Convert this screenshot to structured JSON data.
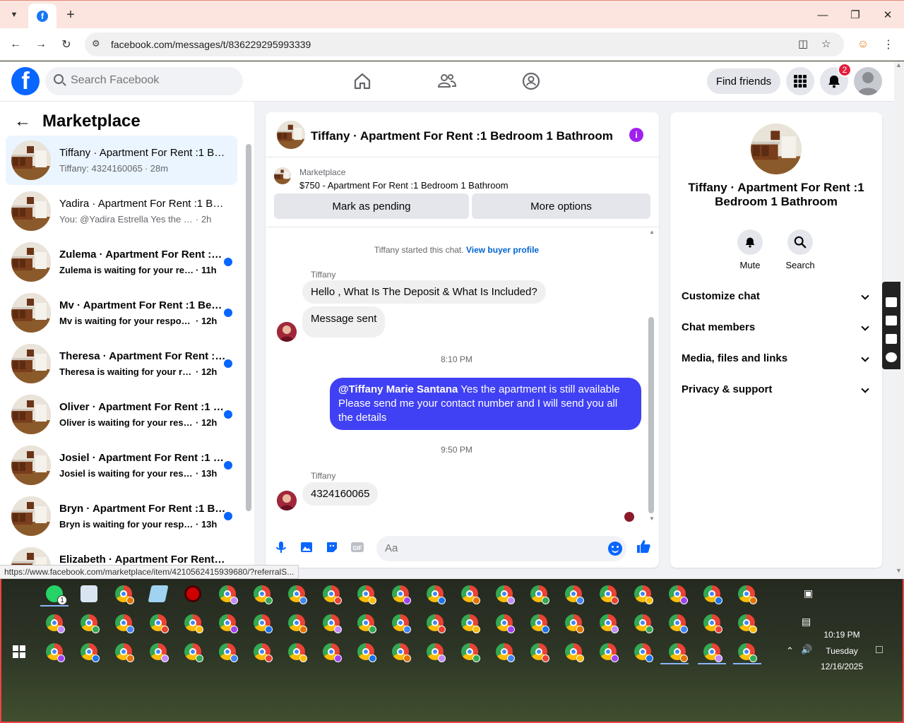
{
  "browser": {
    "url": "facebook.com/messages/t/836229295993339",
    "status_url": "https://www.facebook.com/marketplace/item/4210562415939680/?referralS..."
  },
  "fb_header": {
    "search_placeholder": "Search Facebook",
    "find_friends": "Find friends",
    "notification_count": "2"
  },
  "sidebar": {
    "title": "Marketplace",
    "conversations": [
      {
        "name": "Tiffany · Apartment For Rent :1 Bedroom 1 Bathroom",
        "preview": "Tiffany: 4324160065",
        "time": "· 28m",
        "unread": false,
        "active": true
      },
      {
        "name": "Yadira · Apartment For Rent :1 Bedroom 1 Bathroom",
        "preview": "You: @Yadira Estrella Yes the apartment is still available",
        "time": "· 2h",
        "unread": false,
        "active": false
      },
      {
        "name": "Zulema · Apartment For Rent :1 Bedroom 1 Bathroom",
        "preview": "Zulema is waiting for your response.",
        "time": "· 11h",
        "unread": true,
        "active": false
      },
      {
        "name": "Mv · Apartment For Rent :1 Bedroom 1 Bathroom",
        "preview": "Mv is waiting for your response.",
        "time": "· 12h",
        "unread": true,
        "active": false
      },
      {
        "name": "Theresa · Apartment For Rent :1 Bedroom 1 Bathroom",
        "preview": "Theresa is waiting for your response.",
        "time": "· 12h",
        "unread": true,
        "active": false
      },
      {
        "name": "Oliver · Apartment For Rent :1 Bedroom 1 Bathroom",
        "preview": "Oliver is waiting for your response.",
        "time": "· 12h",
        "unread": true,
        "active": false
      },
      {
        "name": "Josiel · Apartment For Rent :1 Bedroom 1 Bathroom",
        "preview": "Josiel is waiting for your response.",
        "time": "· 13h",
        "unread": true,
        "active": false
      },
      {
        "name": "Bryn · Apartment For Rent :1 Bedroom 1 Bathroom",
        "preview": "Bryn is waiting for your response.",
        "time": "· 13h",
        "unread": true,
        "active": false
      },
      {
        "name": "Elizabeth · Apartment For Rent :1 Bedroom 1 Bathroom",
        "preview": "",
        "time": "",
        "unread": true,
        "active": false
      }
    ]
  },
  "chat": {
    "title": "Tiffany · Apartment For Rent :1 Bedroom 1 Bathroom",
    "listing_source": "Marketplace",
    "listing_title": "$750 - Apartment For Rent :1 Bedroom 1 Bathroom",
    "mark_pending": "Mark as pending",
    "more_options": "More options",
    "started_text": "Tiffany started this chat.",
    "view_buyer": "View buyer profile",
    "sender_name": "Tiffany",
    "msg1": "Hello , What Is The Deposit & What Is Included?",
    "msg2": "Message sent",
    "time1": "8:10 PM",
    "out_mention": "@Tiffany Marie Santana",
    "out_text": " Yes the apartment is still available Please send me your contact number and I will send you all the details",
    "time2": "9:50 PM",
    "msg3": "4324160065",
    "composer_placeholder": "Aa"
  },
  "details": {
    "title": "Tiffany · Apartment For Rent :1 Bedroom 1 Bathroom",
    "mute": "Mute",
    "search": "Search",
    "rows": [
      "Customize chat",
      "Chat members",
      "Media, files and links",
      "Privacy & support"
    ]
  },
  "taskbar": {
    "whatsapp_count": "1",
    "time": "10:19 PM",
    "day": "Tuesday",
    "date": "12/16/2025"
  },
  "colors": {
    "fb_blue": "#0866ff",
    "outgoing_bubble": "#4040f4",
    "unread_dot": "#0866ff",
    "info_icon": "#a020f0"
  }
}
